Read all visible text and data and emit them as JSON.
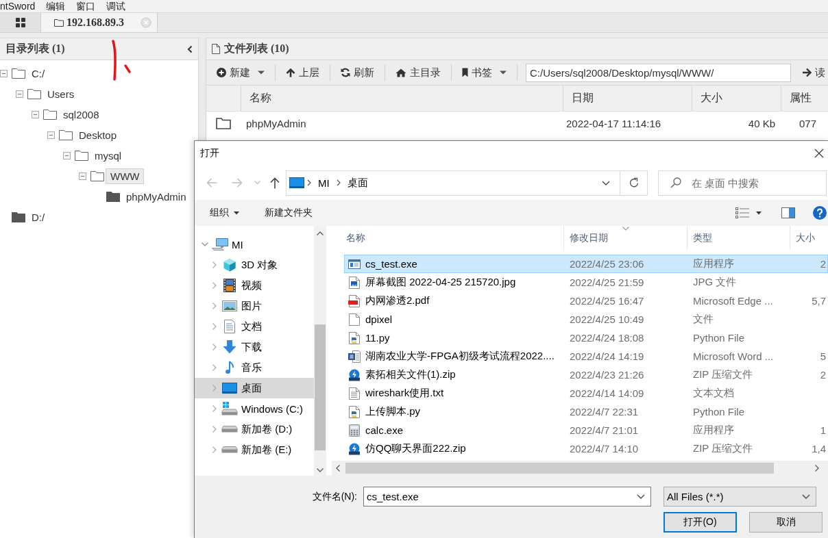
{
  "menu": [
    "ntSword",
    "编辑",
    "窗口",
    "调试"
  ],
  "tabs": [
    {
      "kind": "home",
      "selected": false
    },
    {
      "kind": "host",
      "label": "192.168.89.3",
      "selected": true
    }
  ],
  "directory_panel": {
    "title": "目录列表 (1)",
    "tree": [
      {
        "label": "C:/",
        "expanded": true,
        "selected": false,
        "children": [
          {
            "label": "Users",
            "expanded": true,
            "selected": false,
            "children": [
              {
                "label": "sql2008",
                "expanded": true,
                "selected": false,
                "children": [
                  {
                    "label": "Desktop",
                    "expanded": true,
                    "selected": false,
                    "children": [
                      {
                        "label": "mysql",
                        "expanded": true,
                        "selected": false,
                        "children": [
                          {
                            "label": "WWW",
                            "expanded": true,
                            "selected": true,
                            "children": [
                              {
                                "label": "phpMyAdmin",
                                "expanded": false,
                                "selected": false
                              }
                            ]
                          }
                        ]
                      }
                    ]
                  }
                ]
              }
            ]
          }
        ]
      },
      {
        "label": "D:/",
        "expanded": false,
        "selected": false
      }
    ]
  },
  "file_panel": {
    "title": "文件列表 (10)",
    "toolbar": [
      {
        "kind": "new",
        "label": "新建",
        "dropdown": true
      },
      {
        "kind": "up",
        "label": "上层",
        "dropdown": false
      },
      {
        "kind": "refresh",
        "label": "刷新",
        "dropdown": false
      },
      {
        "kind": "home",
        "label": "主目录",
        "dropdown": false
      },
      {
        "kind": "bookmarks",
        "label": "书签",
        "dropdown": true
      }
    ],
    "path": "C:/Users/sql2008/Desktop/mysql/WWW/",
    "read_button": "读",
    "columns": [
      "名称",
      "日期",
      "大小",
      "属性"
    ],
    "rows": [
      {
        "kind": "folder",
        "name": "phpMyAdmin",
        "date": "2022-04-17 11:14:16",
        "size": "40 Kb",
        "attributes": "077"
      }
    ]
  },
  "open_dialog": {
    "title": "打开",
    "breadcrumb": [
      "MI",
      "桌面"
    ],
    "search_placeholder": "在 桌面 中搜索",
    "toolbar": [
      {
        "label": "组织",
        "dropdown": true
      },
      {
        "label": "新建文件夹",
        "dropdown": false
      }
    ],
    "nav_pane": [
      {
        "kind": "pc",
        "label": "MI",
        "expanded": true,
        "selected": false,
        "children": [
          {
            "kind": "objects3d",
            "label": "3D 对象",
            "expanded": false,
            "selected": false
          },
          {
            "kind": "videos",
            "label": "视频",
            "expanded": false,
            "selected": false
          },
          {
            "kind": "pictures",
            "label": "图片",
            "expanded": false,
            "selected": false
          },
          {
            "kind": "documents",
            "label": "文档",
            "expanded": false,
            "selected": false
          },
          {
            "kind": "downloads",
            "label": "下载",
            "expanded": false,
            "selected": false
          },
          {
            "kind": "music",
            "label": "音乐",
            "expanded": false,
            "selected": false
          },
          {
            "kind": "desktop",
            "label": "桌面",
            "expanded": false,
            "selected": true
          },
          {
            "kind": "system_drive",
            "label": "Windows (C:)",
            "expanded": false,
            "selected": false
          },
          {
            "kind": "drive",
            "label": "新加卷 (D:)",
            "expanded": false,
            "selected": false
          },
          {
            "kind": "drive",
            "label": "新加卷 (E:)",
            "expanded": false,
            "selected": false
          }
        ]
      }
    ],
    "columns": [
      {
        "label": "名称",
        "sorted": false
      },
      {
        "label": "修改日期",
        "sorted": true
      },
      {
        "label": "类型",
        "sorted": false
      },
      {
        "label": "大小",
        "sorted": false
      }
    ],
    "files": [
      {
        "kind": "app",
        "name": "cs_test.exe",
        "date": "2022/4/25 23:06",
        "type": "应用程序",
        "size": "2",
        "selected": true
      },
      {
        "kind": "image",
        "name": "屏幕截图 2022-04-25 215720.jpg",
        "date": "2022/4/25 21:59",
        "type": "JPG 文件",
        "selected": false
      },
      {
        "kind": "pdf",
        "name": "内网渗透2.pdf",
        "date": "2022/4/25 16:47",
        "type": "Microsoft Edge ...",
        "size": "5,7",
        "selected": false
      },
      {
        "kind": "file",
        "name": "dpixel",
        "date": "2022/4/25 10:49",
        "type": "文件",
        "selected": false
      },
      {
        "kind": "python",
        "name": "11.py",
        "date": "2022/4/24 18:08",
        "type": "Python File",
        "selected": false
      },
      {
        "kind": "word",
        "name": "湖南农业大学-FPGA初级考试流程2022....",
        "date": "2022/4/24 14:19",
        "type": "Microsoft Word ...",
        "size": "5",
        "selected": false
      },
      {
        "kind": "zip",
        "name": "素拓相关文件(1).zip",
        "date": "2022/4/23 21:26",
        "type": "ZIP 压缩文件",
        "size": "2",
        "selected": false
      },
      {
        "kind": "text",
        "name": "wireshark使用.txt",
        "date": "2022/4/14 14:09",
        "type": "文本文档",
        "selected": false
      },
      {
        "kind": "python",
        "name": "上传脚本.py",
        "date": "2022/4/7 22:31",
        "type": "Python File",
        "selected": false
      },
      {
        "kind": "calculator",
        "name": "calc.exe",
        "date": "2022/4/7 21:01",
        "type": "应用程序",
        "size": "1",
        "selected": false
      },
      {
        "kind": "zip",
        "name": "仿QQ聊天界面222.zip",
        "date": "2022/4/7 14:10",
        "type": "ZIP 压缩文件",
        "size": "1,4",
        "selected": false
      }
    ],
    "filename_label": "文件名(N):",
    "filename": "cs_test.exe",
    "file_type": "All Files (*.*)",
    "buttons": [
      {
        "label": "打开(O)",
        "default": true
      },
      {
        "label": "取消",
        "default": false
      }
    ]
  }
}
